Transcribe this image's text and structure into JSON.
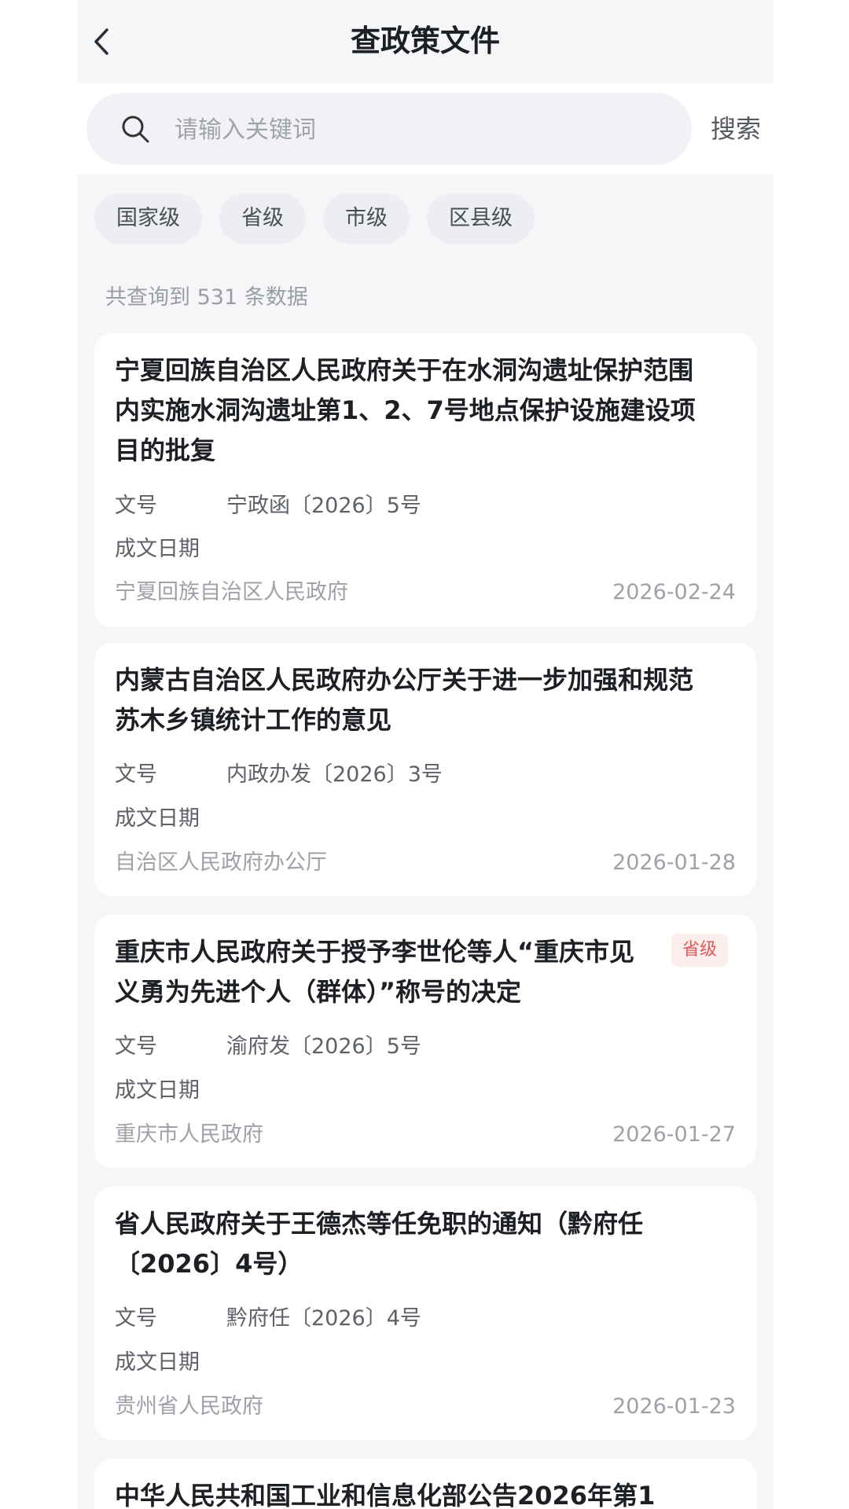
{
  "header": {
    "title": "查政策文件"
  },
  "search": {
    "placeholder": "请输入关键词",
    "value": "",
    "button_label": "搜索"
  },
  "filters": [
    {
      "label": "国家级"
    },
    {
      "label": "省级"
    },
    {
      "label": "市级"
    },
    {
      "label": "区县级"
    }
  ],
  "result_count_text": "共查询到 531 条数据",
  "meta_labels": {
    "doc_no": "文号",
    "date": "成文日期"
  },
  "cards": [
    {
      "title": "宁夏回族自治区人民政府关于在水洞沟遗址保护范围内实施水洞沟遗址第1、2、7号地点保护设施建设项目的批复",
      "badge": "",
      "doc_no": "宁政函〔2026〕5号",
      "issuer": "宁夏回族自治区人民政府",
      "date": "2026-02-24"
    },
    {
      "title": "内蒙古自治区人民政府办公厅关于进一步加强和规范苏木乡镇统计工作的意见",
      "badge": "",
      "doc_no": "内政办发〔2026〕3号",
      "issuer": "自治区人民政府办公厅",
      "date": "2026-01-28"
    },
    {
      "title": "重庆市人民政府关于授予李世伦等人“重庆市见义勇为先进个人（群体）”称号的决定",
      "badge": "省级",
      "doc_no": "渝府发〔2026〕5号",
      "issuer": "重庆市人民政府",
      "date": "2026-01-27"
    },
    {
      "title": "省人民政府关于王德杰等任免职的通知（黔府任〔2026〕4号）",
      "badge": "",
      "doc_no": "黔府任〔2026〕4号",
      "issuer": "贵州省人民政府",
      "date": "2026-01-23"
    },
    {
      "title": "中华人民共和国工业和信息化部公告2026年第1"
    }
  ],
  "colors": {
    "background": "#f5f6f8",
    "card": "#ffffff",
    "badge_text": "#e05a5a",
    "badge_bg": "#fdeeee"
  }
}
